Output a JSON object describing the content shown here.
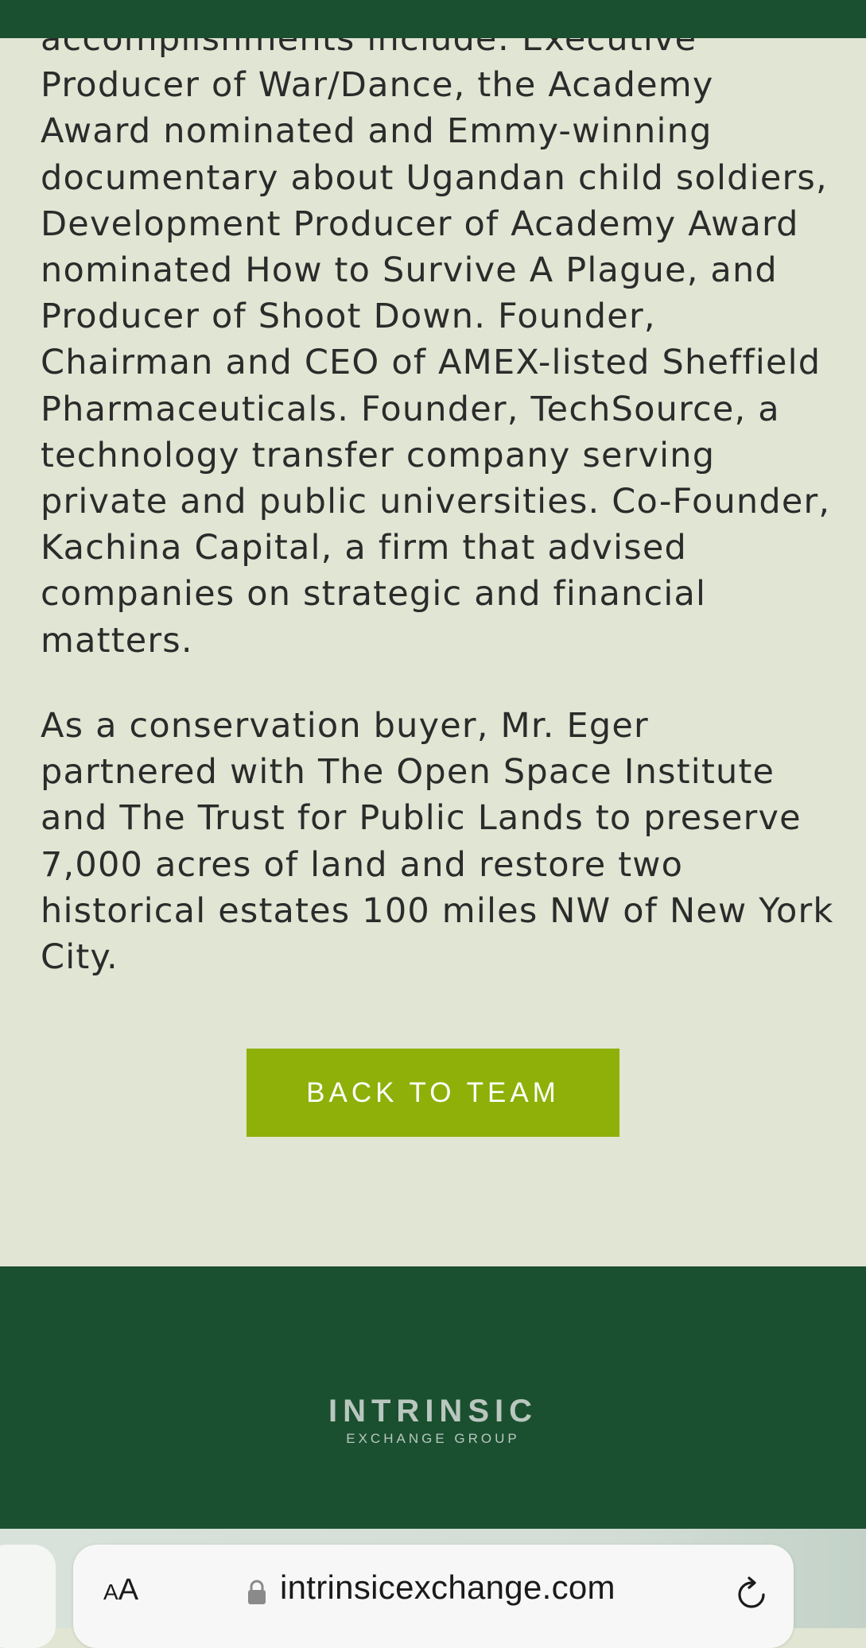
{
  "bio": {
    "paragraph_1": "accomplishments include: Executive Producer of War/Dance, the Academy Award nominated and Emmy-winning documentary about Ugandan child soldiers, Development Producer of Academy Award nominated How to Survive A Plague, and Producer of Shoot Down. Founder, Chairman and CEO of AMEX-listed Sheffield Pharmaceuticals. Founder, TechSource, a technology transfer company serving private and public universities. Co-Founder, Kachina Capital, a firm that advised companies on strategic and financial matters.",
    "paragraph_2": "As a conservation buyer, Mr. Eger partnered with The Open Space Institute and The Trust for Public Lands to preserve 7,000 acres of land and restore two historical estates 100 miles NW of New York City."
  },
  "cta": {
    "back_label": "BACK TO TEAM"
  },
  "footer": {
    "logo_main": "INTRINSIC",
    "logo_sub": "EXCHANGE GROUP"
  },
  "browser": {
    "aa_label_small": "A",
    "aa_label_large": "A",
    "url": "intrinsicexchange.com",
    "lock_icon": "lock-icon",
    "reload_icon": "reload-icon"
  },
  "colors": {
    "header_green": "#1a5030",
    "page_bg": "#e1e5d3",
    "button_green": "#8eb008",
    "footer_green": "#1a5030"
  }
}
